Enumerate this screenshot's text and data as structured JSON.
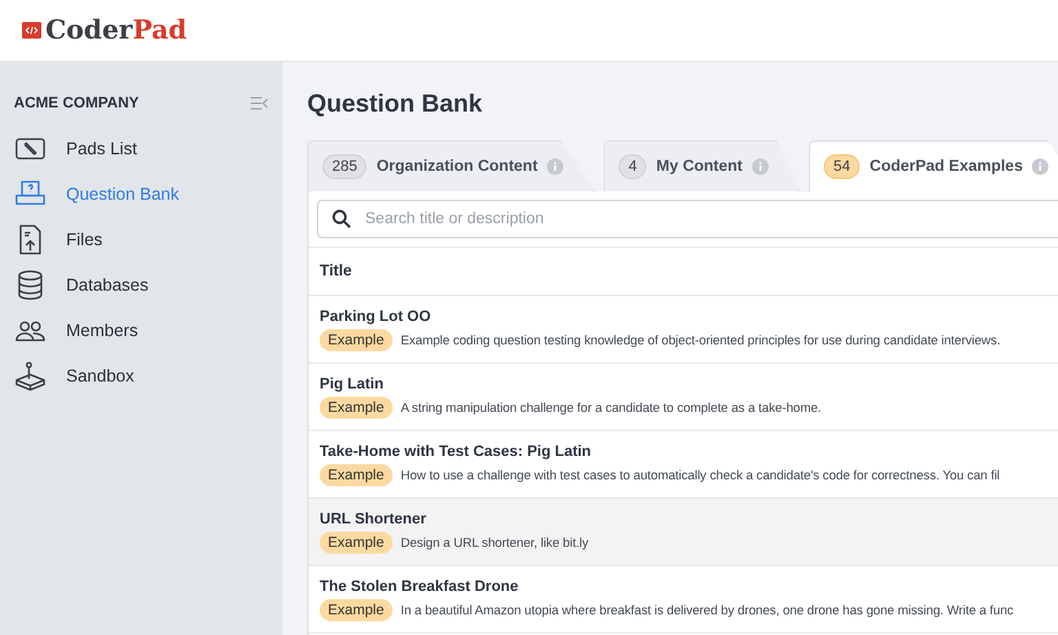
{
  "logo": {
    "prefix": "Coder",
    "suffix": "Pad"
  },
  "sidebar": {
    "company": "ACME COMPANY",
    "items": [
      {
        "label": "Pads List",
        "kind": "pencil",
        "selected": false
      },
      {
        "label": "Question Bank",
        "kind": "bank",
        "selected": true
      },
      {
        "label": "Files",
        "kind": "file",
        "selected": false
      },
      {
        "label": "Databases",
        "kind": "database",
        "selected": false
      },
      {
        "label": "Members",
        "kind": "members",
        "selected": false
      },
      {
        "label": "Sandbox",
        "kind": "sandbox",
        "selected": false
      }
    ]
  },
  "page_title": "Question Bank",
  "tabs": [
    {
      "count": "285",
      "label": "Organization Content",
      "selected": false
    },
    {
      "count": "4",
      "label": "My Content",
      "selected": false
    },
    {
      "count": "54",
      "label": "CoderPad Examples",
      "selected": true
    }
  ],
  "search": {
    "placeholder": "Search title or description"
  },
  "table": {
    "columns": [
      "Title"
    ],
    "rows": [
      {
        "title": "Parking Lot OO",
        "badge": "Example",
        "description": "Example coding question testing knowledge of object-oriented principles for use during candidate interviews.",
        "selected": false
      },
      {
        "title": "Pig Latin",
        "badge": "Example",
        "description": "A string manipulation challenge for a candidate to complete as a take-home.",
        "selected": false
      },
      {
        "title": "Take-Home with Test Cases: Pig Latin",
        "badge": "Example",
        "description": "How to use a challenge with test cases to automatically check a candidate's code for correctness. You can fil",
        "selected": false
      },
      {
        "title": "URL Shortener",
        "badge": "Example",
        "description": "Design a URL shortener, like bit.ly",
        "selected": true
      },
      {
        "title": "The Stolen Breakfast Drone",
        "badge": "Example",
        "description": "In a beautiful Amazon utopia where breakfast is delivered by drones, one drone has gone missing. Write a func",
        "selected": false
      }
    ]
  }
}
